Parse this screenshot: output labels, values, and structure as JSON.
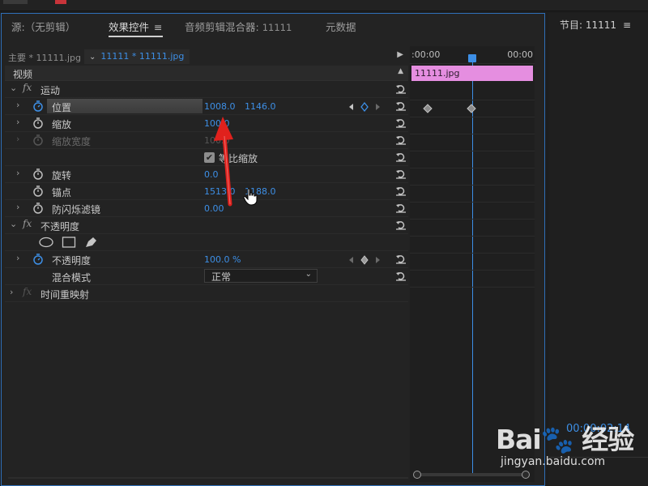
{
  "tabs": [
    {
      "label": "源:（无剪辑）",
      "active": false
    },
    {
      "label": "效果控件",
      "active": true
    },
    {
      "label": "音频剪辑混合器:",
      "num": "11111",
      "active": false
    },
    {
      "label": "元数据",
      "active": false
    }
  ],
  "menu_glyph": "≡",
  "clip_header": {
    "master": "主要 * 11111.jpg",
    "sequence": "11111 * 11111.jpg"
  },
  "video_header": "视频",
  "effects": {
    "motion": {
      "label": "运动",
      "position": {
        "label": "位置",
        "x": "1008.0",
        "y": "1146.0"
      },
      "scale": {
        "label": "缩放",
        "value": "100.0"
      },
      "scale_width": {
        "label": "缩放宽度",
        "value": "100.0"
      },
      "uniform_scale": {
        "label": "等比缩放",
        "checked": true
      },
      "rotation": {
        "label": "旋转",
        "value": "0.0"
      },
      "anchor": {
        "label": "锚点",
        "x": "1513.0",
        "y": "1188.0"
      },
      "anti_flicker": {
        "label": "防闪烁滤镜",
        "value": "0.00"
      }
    },
    "opacity": {
      "label": "不透明度",
      "opacity": {
        "label": "不透明度",
        "value": "100.0 %"
      },
      "blend_mode": {
        "label": "混合模式",
        "value": "正常"
      }
    },
    "time_remap": {
      "label": "时间重映射"
    }
  },
  "timeline": {
    "start": ":00:00",
    "end": "00:00",
    "clip_name": "11111.jpg",
    "playhead_color": "#3d8fe6",
    "clip_color": "#e58ee0"
  },
  "program": {
    "title": "节目: 11111",
    "timecode": "00:00:02:14"
  },
  "watermark": {
    "logo": "Bai🐾 经验",
    "url": "jingyan.baidu.com"
  },
  "colors": {
    "accent": "#3d8fe6",
    "panel_border": "#2f6fb8",
    "annotation_arrow": "#e0211d"
  },
  "icons": {
    "stopwatch": "stopwatch-icon",
    "reset": "reset-icon",
    "ellipse_mask": "ellipse-mask-icon",
    "rect_mask": "rectangle-mask-icon",
    "pen_mask": "pen-mask-icon"
  }
}
